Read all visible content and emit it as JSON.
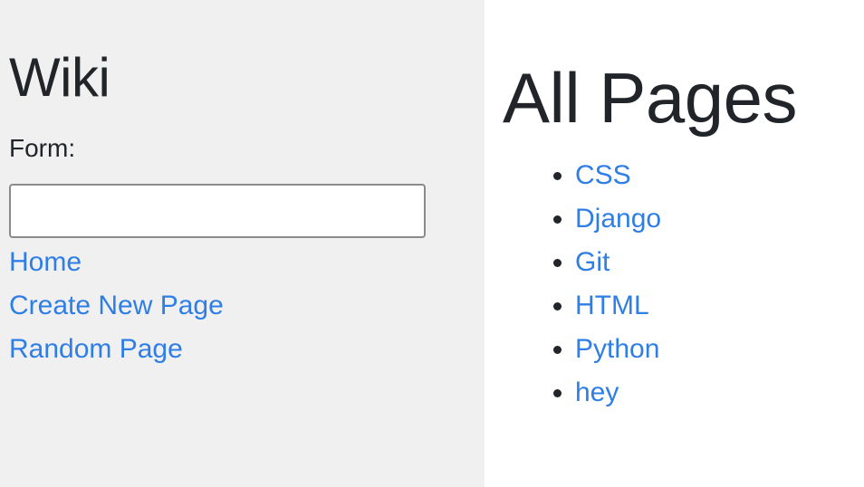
{
  "sidebar": {
    "title": "Wiki",
    "form_label": "Form:",
    "search_value": "",
    "nav": [
      {
        "label": "Home"
      },
      {
        "label": "Create New Page"
      },
      {
        "label": "Random Page"
      }
    ]
  },
  "main": {
    "heading": "All Pages",
    "pages": [
      {
        "label": "CSS"
      },
      {
        "label": "Django"
      },
      {
        "label": "Git"
      },
      {
        "label": "HTML"
      },
      {
        "label": "Python"
      },
      {
        "label": "hey"
      }
    ]
  },
  "colors": {
    "link": "#2f7ee6",
    "sidebar_bg": "#f0f0f0",
    "text": "#212529"
  }
}
